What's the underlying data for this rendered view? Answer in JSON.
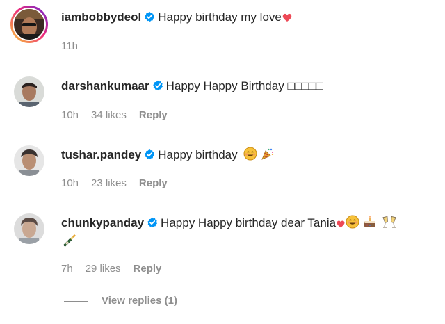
{
  "comments": [
    {
      "username": "iambobbydeol",
      "text": "Happy birthday my love",
      "trailing": "❤",
      "time": "11h",
      "likes": "",
      "reply": ""
    },
    {
      "username": "darshankumaar",
      "text": "Happy Happy Birthday □□□□□",
      "time": "10h",
      "likes": "34 likes",
      "reply": "Reply"
    },
    {
      "username": "tushar.pandey",
      "text": "Happy birthday",
      "time": "10h",
      "likes": "23 likes",
      "reply": "Reply"
    },
    {
      "username": "chunkypanday",
      "text": "Happy Happy birthday dear Tania",
      "time": "7h",
      "likes": "29 likes",
      "reply": "Reply"
    }
  ],
  "view_replies": "View replies (1)",
  "colors": {
    "text": "#262626",
    "meta": "#8e8e8e",
    "verified": "#0095f6",
    "heart": "#ed4956"
  },
  "icons": [
    "verified-badge-icon",
    "heart-icon",
    "smiling-face-icon",
    "party-popper-icon",
    "birthday-cake-icon",
    "clinking-glasses-icon",
    "champagne-bottle-icon"
  ]
}
